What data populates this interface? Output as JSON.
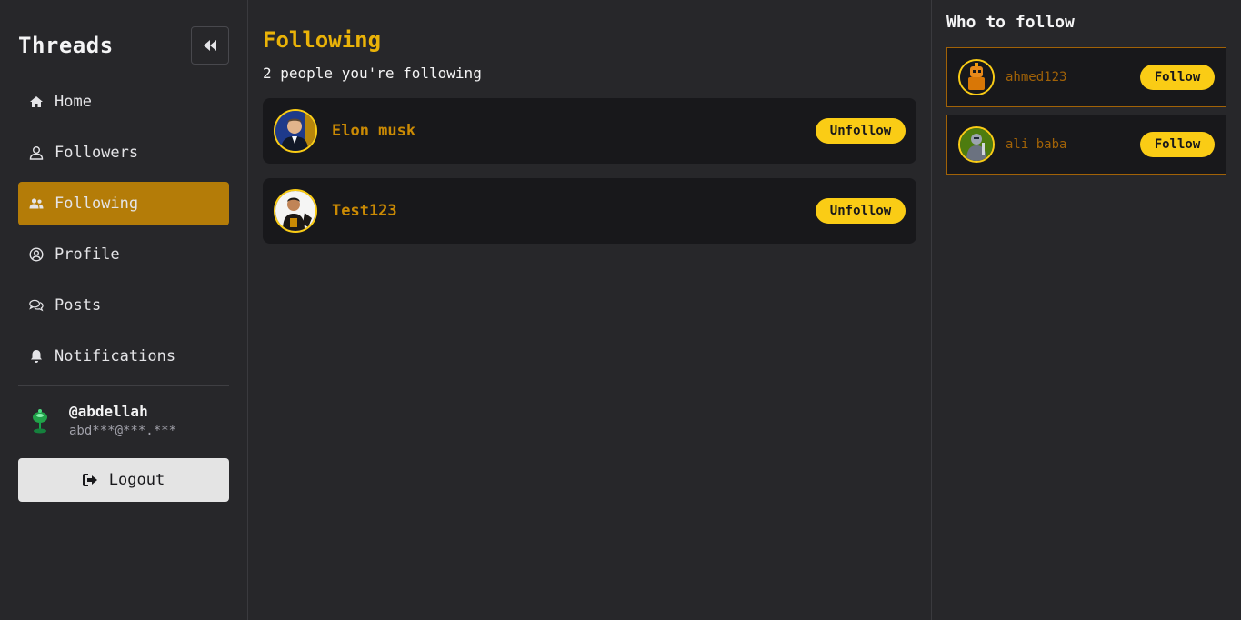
{
  "sidebar": {
    "brand": "Threads",
    "items": [
      {
        "label": "Home",
        "icon": "home-icon"
      },
      {
        "label": "Followers",
        "icon": "user-icon"
      },
      {
        "label": "Following",
        "icon": "users-icon"
      },
      {
        "label": "Profile",
        "icon": "user-circle-icon"
      },
      {
        "label": "Posts",
        "icon": "chat-icon"
      },
      {
        "label": "Notifications",
        "icon": "bell-icon"
      }
    ],
    "active_item": "Following",
    "user": {
      "handle": "@abdellah",
      "email": "abd***@***.***"
    },
    "logout_label": "Logout"
  },
  "main": {
    "title": "Following",
    "subtitle": "2 people you're following",
    "following": [
      {
        "name": "Elon musk",
        "action": "Unfollow"
      },
      {
        "name": "Test123",
        "action": "Unfollow"
      }
    ]
  },
  "right": {
    "title": "Who to follow",
    "suggestions": [
      {
        "name": "ahmed123",
        "action": "Follow"
      },
      {
        "name": "ali baba",
        "action": "Follow"
      }
    ]
  },
  "colors": {
    "accent": "#facc15",
    "active_nav": "#b47c08",
    "name_text": "#ca8a04",
    "background": "#27272a",
    "card": "#18181b"
  }
}
